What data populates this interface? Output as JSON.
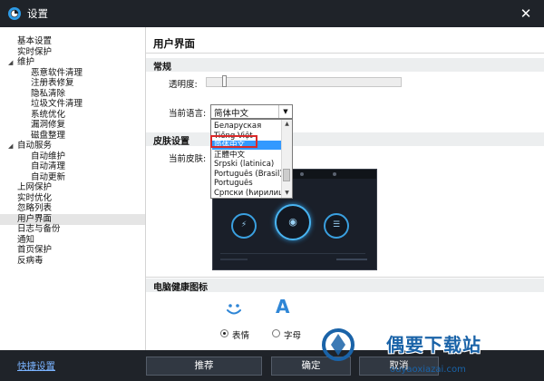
{
  "window": {
    "title": "设置",
    "close_glyph": "✕",
    "app_icon": "app-logo-icon"
  },
  "sidebar": {
    "items": [
      {
        "label": "基本设置",
        "level": 0,
        "toggle": ""
      },
      {
        "label": "实时保护",
        "level": 0,
        "toggle": ""
      },
      {
        "label": "维护",
        "level": 0,
        "toggle": "◢"
      },
      {
        "label": "恶意软件清理",
        "level": 1,
        "toggle": ""
      },
      {
        "label": "注册表修复",
        "level": 1,
        "toggle": ""
      },
      {
        "label": "隐私清除",
        "level": 1,
        "toggle": ""
      },
      {
        "label": "垃圾文件清理",
        "level": 1,
        "toggle": ""
      },
      {
        "label": "系统优化",
        "level": 1,
        "toggle": ""
      },
      {
        "label": "漏洞修复",
        "level": 1,
        "toggle": ""
      },
      {
        "label": "磁盘整理",
        "level": 1,
        "toggle": ""
      },
      {
        "label": "自动服务",
        "level": 0,
        "toggle": "◢"
      },
      {
        "label": "自动维护",
        "level": 1,
        "toggle": ""
      },
      {
        "label": "自动清理",
        "level": 1,
        "toggle": ""
      },
      {
        "label": "自动更新",
        "level": 1,
        "toggle": ""
      },
      {
        "label": "上网保护",
        "level": 0,
        "toggle": ""
      },
      {
        "label": "实时优化",
        "level": 0,
        "toggle": ""
      },
      {
        "label": "忽略列表",
        "level": 0,
        "toggle": ""
      },
      {
        "label": "用户界面",
        "level": 0,
        "toggle": "",
        "selected": true
      },
      {
        "label": "日志与备份",
        "level": 0,
        "toggle": ""
      },
      {
        "label": "通知",
        "level": 0,
        "toggle": ""
      },
      {
        "label": "首页保护",
        "level": 0,
        "toggle": ""
      },
      {
        "label": "反病毒",
        "level": 0,
        "toggle": ""
      }
    ]
  },
  "content": {
    "page_title": "用户界面",
    "general": {
      "section_title": "常规",
      "transparency_label": "透明度:",
      "transparency_value": 0.08,
      "language_label": "当前语言:",
      "language_value": "简体中文",
      "language_options": [
        "Беларуская",
        "Tiếng Việt",
        "简体中文",
        "正體中文",
        "Srpski (latinica)",
        "Português (Brasil)",
        "Português",
        "Српски (ћирилица)"
      ],
      "language_highlighted_index": 2
    },
    "skin": {
      "section_title": "皮肤设置",
      "current_skin_label": "当前皮肤:"
    },
    "health": {
      "section_title": "电脑健康图标",
      "options": [
        {
          "label": "表情",
          "icon": "smiley-face-icon",
          "glyph": "",
          "selected": true
        },
        {
          "label": "字母",
          "icon": "letter-a-icon",
          "glyph": "A",
          "selected": false
        }
      ]
    }
  },
  "footer": {
    "quick_settings_link": "快捷设置",
    "recommend_button": "推荐",
    "ok_button": "确定",
    "cancel_button": "取消"
  },
  "watermark": {
    "text": "偶要下载站",
    "url": "ouyaoxiazai.com"
  },
  "colors": {
    "titlebar": "#1f2329",
    "accent": "#3399ff",
    "highlight_border": "#d92a2a",
    "link": "#7ab3ff"
  }
}
